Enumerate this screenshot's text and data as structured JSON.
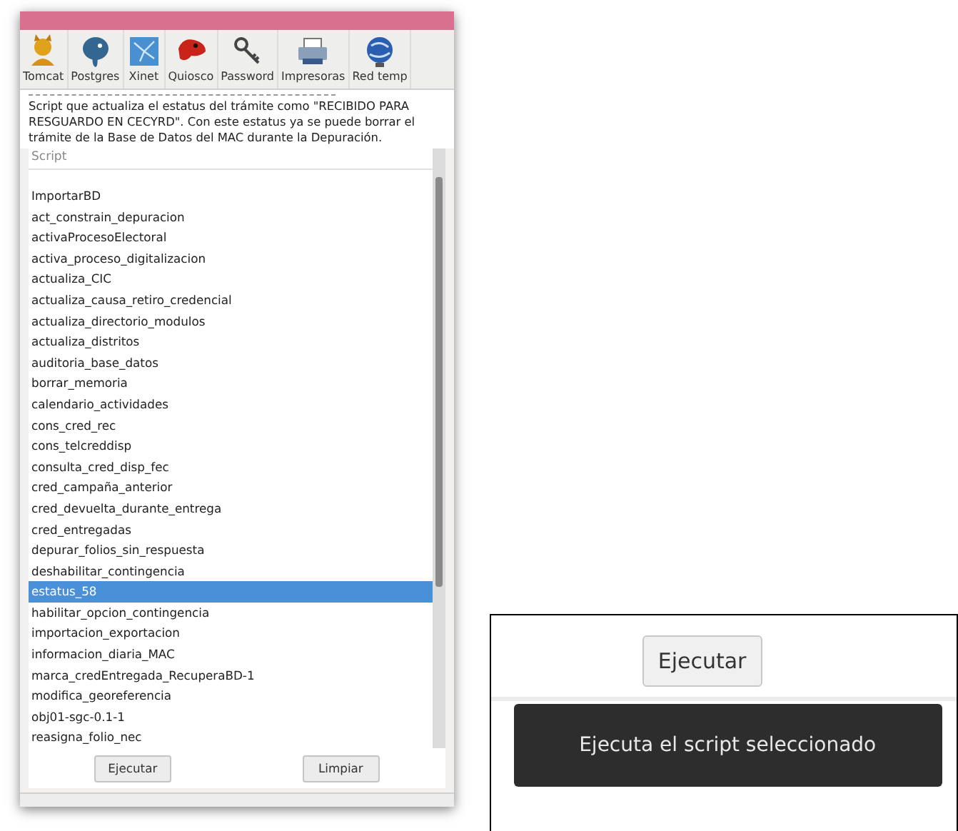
{
  "window": {
    "toolbar": [
      {
        "label": "Tomcat"
      },
      {
        "label": "Postgres"
      },
      {
        "label": "Xinet"
      },
      {
        "label": "Quiosco"
      },
      {
        "label": "Password"
      },
      {
        "label": "Impresoras"
      },
      {
        "label": "Red temp"
      }
    ],
    "description": "Script que actualiza el estatus del trámite  como \"RECIBIDO PARA RESGUARDO EN CECYRD\". Con este estatus ya se puede borrar el trámite de la Base de Datos del MAC durante la Depuración.",
    "list": {
      "header": "Script",
      "items": [
        {
          "label": "ImportarBD",
          "selected": false
        },
        {
          "label": "act_constrain_depuracion",
          "selected": false
        },
        {
          "label": "activaProcesoElectoral",
          "selected": false
        },
        {
          "label": "activa_proceso_digitalizacion",
          "selected": false
        },
        {
          "label": "actualiza_CIC",
          "selected": false
        },
        {
          "label": "actualiza_causa_retiro_credencial",
          "selected": false
        },
        {
          "label": "actualiza_directorio_modulos",
          "selected": false
        },
        {
          "label": "actualiza_distritos",
          "selected": false
        },
        {
          "label": "auditoria_base_datos",
          "selected": false
        },
        {
          "label": "borrar_memoria",
          "selected": false
        },
        {
          "label": "calendario_actividades",
          "selected": false
        },
        {
          "label": "cons_cred_rec",
          "selected": false
        },
        {
          "label": "cons_telcreddisp",
          "selected": false
        },
        {
          "label": "consulta_cred_disp_fec",
          "selected": false
        },
        {
          "label": "cred_campaña_anterior",
          "selected": false
        },
        {
          "label": "cred_devuelta_durante_entrega",
          "selected": false
        },
        {
          "label": "cred_entregadas",
          "selected": false
        },
        {
          "label": "depurar_folios_sin_respuesta",
          "selected": false
        },
        {
          "label": "deshabilitar_contingencia",
          "selected": false
        },
        {
          "label": "estatus_58",
          "selected": true
        },
        {
          "label": "habilitar_opcion_contingencia",
          "selected": false
        },
        {
          "label": "importacion_exportacion",
          "selected": false
        },
        {
          "label": "informacion_diaria_MAC",
          "selected": false
        },
        {
          "label": "marca_credEntregada_RecuperaBD-1",
          "selected": false
        },
        {
          "label": "modifica_georeferencia",
          "selected": false
        },
        {
          "label": "obj01-sgc-0.1-1",
          "selected": false
        },
        {
          "label": "reasigna_folio_nec",
          "selected": false
        }
      ]
    },
    "buttons": [
      "Ejecutar",
      "Limpiar"
    ]
  },
  "zoom_inset": {
    "button": "Ejecutar",
    "tooltip": "Ejecuta el script seleccionado"
  }
}
